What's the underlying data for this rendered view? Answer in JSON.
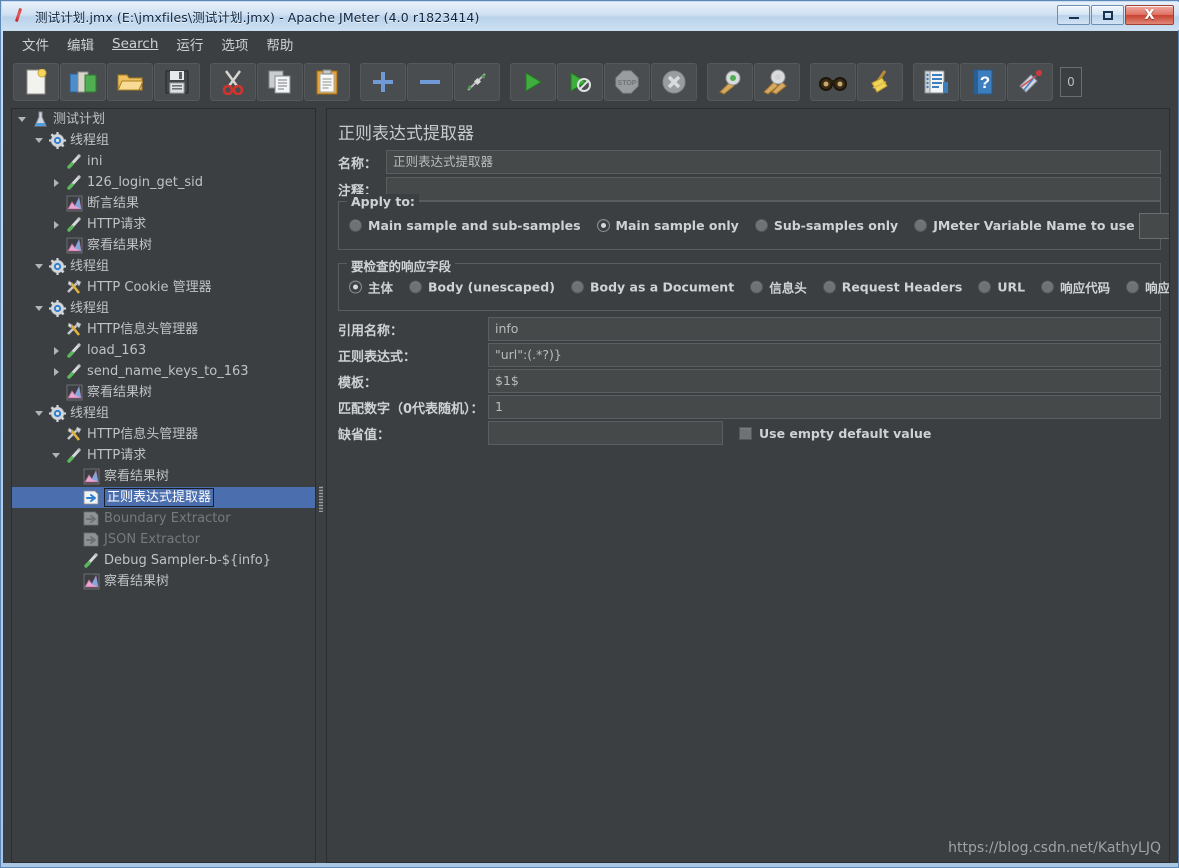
{
  "window": {
    "title": "测试计划.jmx (E:\\jmxfiles\\测试计划.jmx) - Apache JMeter (4.0 r1823414)",
    "icon": "jmeter-pipette-icon",
    "buttons": {
      "minimize": "minimize-button",
      "maximize": "maximize-button",
      "close": "X"
    }
  },
  "menubar": {
    "items": [
      {
        "label": "文件",
        "mnemonic": false
      },
      {
        "label": "编辑",
        "mnemonic": false
      },
      {
        "label": "Search",
        "mnemonic": true
      },
      {
        "label": "运行",
        "mnemonic": false
      },
      {
        "label": "选项",
        "mnemonic": false
      },
      {
        "label": "帮助",
        "mnemonic": false
      }
    ]
  },
  "toolbar": {
    "counter": "0",
    "buttons": [
      {
        "name": "new-icon",
        "tip": "New"
      },
      {
        "name": "templates-icon",
        "tip": "Templates"
      },
      {
        "name": "open-icon",
        "tip": "Open"
      },
      {
        "name": "save-icon",
        "tip": "Save"
      },
      {
        "name": "cut-icon",
        "tip": "Cut"
      },
      {
        "name": "copy-icon",
        "tip": "Copy"
      },
      {
        "name": "paste-icon",
        "tip": "Paste"
      },
      {
        "name": "expand-all-icon",
        "tip": "Expand All"
      },
      {
        "name": "collapse-all-icon",
        "tip": "Collapse All"
      },
      {
        "name": "toggle-icon",
        "tip": "Toggle"
      },
      {
        "name": "start-icon",
        "tip": "Start"
      },
      {
        "name": "start-no-pauses-icon",
        "tip": "Start no pauses"
      },
      {
        "name": "stop-icon",
        "tip": "Stop"
      },
      {
        "name": "shutdown-icon",
        "tip": "Shutdown"
      },
      {
        "name": "clear-icon",
        "tip": "Clear"
      },
      {
        "name": "clear-all-icon",
        "tip": "Clear All"
      },
      {
        "name": "search-icon",
        "tip": "Search"
      },
      {
        "name": "reset-search-icon",
        "tip": "Reset Search"
      },
      {
        "name": "function-helper-icon",
        "tip": "Function Helper Dialog"
      },
      {
        "name": "help-icon",
        "tip": "Help"
      },
      {
        "name": "undo-icon",
        "tip": "Undo"
      }
    ]
  },
  "tree": {
    "nodes": [
      {
        "label": "测试计划",
        "indent": 0,
        "twist": "open",
        "icon": "test-plan-icon",
        "state": "normal"
      },
      {
        "label": "线程组",
        "indent": 1,
        "twist": "open",
        "icon": "thread-group-icon",
        "state": "normal"
      },
      {
        "label": "ini",
        "indent": 2,
        "twist": "none",
        "icon": "sampler-icon",
        "state": "normal"
      },
      {
        "label": "126_login_get_sid",
        "indent": 2,
        "twist": "closed",
        "icon": "sampler-icon",
        "state": "normal"
      },
      {
        "label": "断言结果",
        "indent": 2,
        "twist": "none",
        "icon": "listener-icon",
        "state": "normal"
      },
      {
        "label": "HTTP请求",
        "indent": 2,
        "twist": "closed",
        "icon": "sampler-icon",
        "state": "normal"
      },
      {
        "label": "察看结果树",
        "indent": 2,
        "twist": "none",
        "icon": "listener-icon",
        "state": "normal"
      },
      {
        "label": "线程组",
        "indent": 1,
        "twist": "open",
        "icon": "thread-group-icon",
        "state": "normal"
      },
      {
        "label": "HTTP Cookie 管理器",
        "indent": 2,
        "twist": "none",
        "icon": "config-icon",
        "state": "normal"
      },
      {
        "label": "线程组",
        "indent": 1,
        "twist": "open",
        "icon": "thread-group-icon",
        "state": "normal"
      },
      {
        "label": "HTTP信息头管理器",
        "indent": 2,
        "twist": "none",
        "icon": "config-icon",
        "state": "normal"
      },
      {
        "label": "load_163",
        "indent": 2,
        "twist": "closed",
        "icon": "sampler-icon",
        "state": "normal"
      },
      {
        "label": "send_name_keys_to_163",
        "indent": 2,
        "twist": "closed",
        "icon": "sampler-icon",
        "state": "normal"
      },
      {
        "label": "察看结果树",
        "indent": 2,
        "twist": "none",
        "icon": "listener-icon",
        "state": "normal"
      },
      {
        "label": "线程组",
        "indent": 1,
        "twist": "open",
        "icon": "thread-group-icon",
        "state": "normal"
      },
      {
        "label": "HTTP信息头管理器",
        "indent": 2,
        "twist": "none",
        "icon": "config-icon",
        "state": "normal"
      },
      {
        "label": "HTTP请求",
        "indent": 2,
        "twist": "open",
        "icon": "sampler-icon",
        "state": "normal"
      },
      {
        "label": "察看结果树",
        "indent": 3,
        "twist": "none",
        "icon": "listener-icon",
        "state": "normal"
      },
      {
        "label": "正则表达式提取器",
        "indent": 3,
        "twist": "none",
        "icon": "post-processor-icon",
        "state": "selected"
      },
      {
        "label": "Boundary Extractor",
        "indent": 3,
        "twist": "none",
        "icon": "post-processor-icon",
        "state": "disabled"
      },
      {
        "label": "JSON Extractor",
        "indent": 3,
        "twist": "none",
        "icon": "post-processor-icon",
        "state": "disabled"
      },
      {
        "label": "Debug Sampler-b-${info}",
        "indent": 3,
        "twist": "none",
        "icon": "sampler-icon",
        "state": "normal"
      },
      {
        "label": "察看结果树",
        "indent": 3,
        "twist": "none",
        "icon": "listener-icon",
        "state": "normal"
      }
    ]
  },
  "panel": {
    "title": "正则表达式提取器",
    "name_label": "名称：",
    "name_value": "正则表达式提取器",
    "comment_label": "注释：",
    "comment_value": "",
    "apply_to": {
      "legend": "Apply to:",
      "options": [
        {
          "label": "Main sample and sub-samples",
          "checked": false
        },
        {
          "label": "Main sample only",
          "checked": true
        },
        {
          "label": "Sub-samples only",
          "checked": false
        },
        {
          "label": "JMeter Variable Name to use",
          "checked": false
        }
      ],
      "variable_value": ""
    },
    "response_field": {
      "legend": "要检查的响应字段",
      "options": [
        {
          "label": "主体",
          "checked": true
        },
        {
          "label": "Body (unescaped)",
          "checked": false
        },
        {
          "label": "Body as a Document",
          "checked": false
        },
        {
          "label": "信息头",
          "checked": false
        },
        {
          "label": "Request Headers",
          "checked": false
        },
        {
          "label": "URL",
          "checked": false
        },
        {
          "label": "响应代码",
          "checked": false
        },
        {
          "label": "响应信息",
          "checked": false
        }
      ]
    },
    "fields": [
      {
        "label": "引用名称：",
        "value": "info"
      },
      {
        "label": "正则表达式：",
        "value": "\"url\":(.*?)}"
      },
      {
        "label": "模板：",
        "value": "$1$"
      },
      {
        "label": "匹配数字（0代表随机）：",
        "value": "1"
      }
    ],
    "default_label": "缺省值：",
    "default_value": "",
    "use_empty_default_label": "Use empty default value",
    "use_empty_default_checked": false
  },
  "watermark": "https://blog.csdn.net/KathyLJQ",
  "colors": {
    "panel_bg": "#3c3f41",
    "field_bg": "#45494a",
    "text": "#cfd2d4",
    "selection": "#4b6eaf",
    "title_chrome": "#cfe0f2"
  }
}
